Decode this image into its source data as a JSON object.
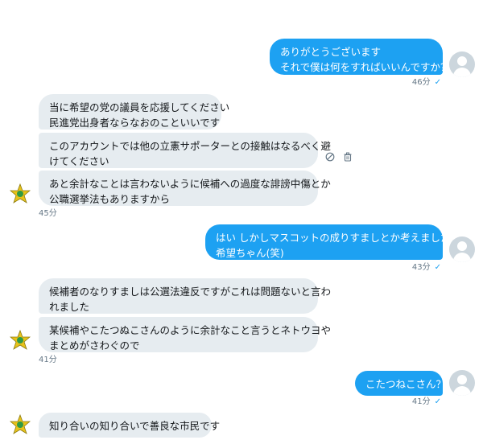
{
  "thread": {
    "messages": [
      {
        "id": "m1",
        "lines": [
          "ありがとうございます",
          "それで僕は何をすればいいんですか？"
        ],
        "time": "46分",
        "read": "✓"
      },
      {
        "id": "m2",
        "lines": [
          "当に希望の党の議員を応援してください",
          "民進党出身者ならなおのこといいです"
        ]
      },
      {
        "id": "m3",
        "lines": [
          "このアカウントでは他の立憲サポーターとの接触はなるべく避",
          "けてください"
        ]
      },
      {
        "id": "m4",
        "lines": [
          "あと余計なことは言わないように候補への過度な誹謗中傷とか",
          "公職選挙法もありますから"
        ],
        "time": "45分"
      },
      {
        "id": "m5",
        "lines": [
          "はい しかしマスコットの成りすましとか考えましたね",
          "希望ちゃん(笑)"
        ],
        "time": "43分",
        "read": "✓"
      },
      {
        "id": "m6",
        "lines": [
          "候補者のなりすましは公選法違反ですがこれは問題ないと言わ",
          "れました"
        ]
      },
      {
        "id": "m7",
        "lines": [
          "某候補やこたつぬこさんのように余計なこと言うとネトウヨや",
          "まとめがさわぐので"
        ],
        "time": "41分"
      },
      {
        "id": "m8",
        "lines": [
          "こたつねこさん？"
        ],
        "time": "41分",
        "read": "✓"
      },
      {
        "id": "m9",
        "lines": [
          "知り合いの知り合いで善良な市民です"
        ]
      }
    ]
  },
  "colors": {
    "outgoing_bubble": "#1da1f2",
    "incoming_bubble": "#e6ecf0",
    "timestamp": "#657786",
    "read_check": "#1da1f2",
    "avatar_placeholder": "#ccd6dd"
  },
  "icons": {
    "user_avatar": "default-user-icon",
    "mascot_avatar": "mascot-icon",
    "message_actions": [
      "block-icon",
      "trash-icon"
    ]
  }
}
